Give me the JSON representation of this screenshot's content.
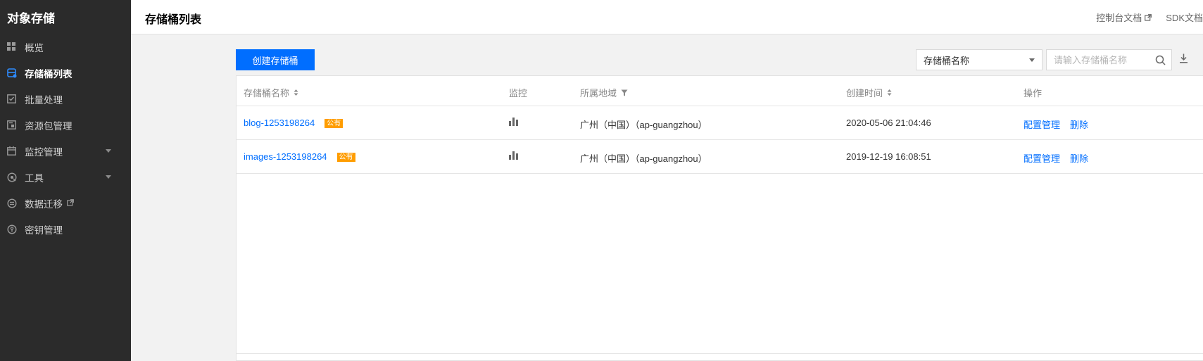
{
  "sidebar": {
    "brand": "对象存储",
    "items": [
      {
        "label": "概览"
      },
      {
        "label": "存储桶列表"
      },
      {
        "label": "批量处理"
      },
      {
        "label": "资源包管理"
      },
      {
        "label": "监控管理"
      },
      {
        "label": "工具"
      },
      {
        "label": "数据迁移"
      },
      {
        "label": "密钥管理"
      }
    ]
  },
  "header": {
    "title": "存储桶列表",
    "console_docs": "控制台文档",
    "sdk_docs": "SDK文档"
  },
  "toolbar": {
    "create_label": "创建存储桶",
    "filter_selected": "存储桶名称",
    "search_placeholder": "请输入存储桶名称"
  },
  "table": {
    "headers": {
      "name": "存储桶名称",
      "monitor": "监控",
      "region": "所属地域",
      "created": "创建时间",
      "ops": "操作"
    },
    "rows": [
      {
        "name": "blog-1253198264",
        "badge": "公有",
        "region": "广州（中国）（ap-guangzhou）",
        "created": "2020-05-06 21:04:46",
        "op_config": "配置管理",
        "op_delete": "删除"
      },
      {
        "name": "images-1253198264",
        "badge": "公有",
        "region": "广州（中国）（ap-guangzhou）",
        "created": "2019-12-19 16:08:51",
        "op_config": "配置管理",
        "op_delete": "删除"
      }
    ]
  },
  "colors": {
    "accent": "#006eff",
    "badge": "#ff9d00",
    "sidebar_bg": "#2b2b2b",
    "active_icon": "#2e8cff"
  }
}
